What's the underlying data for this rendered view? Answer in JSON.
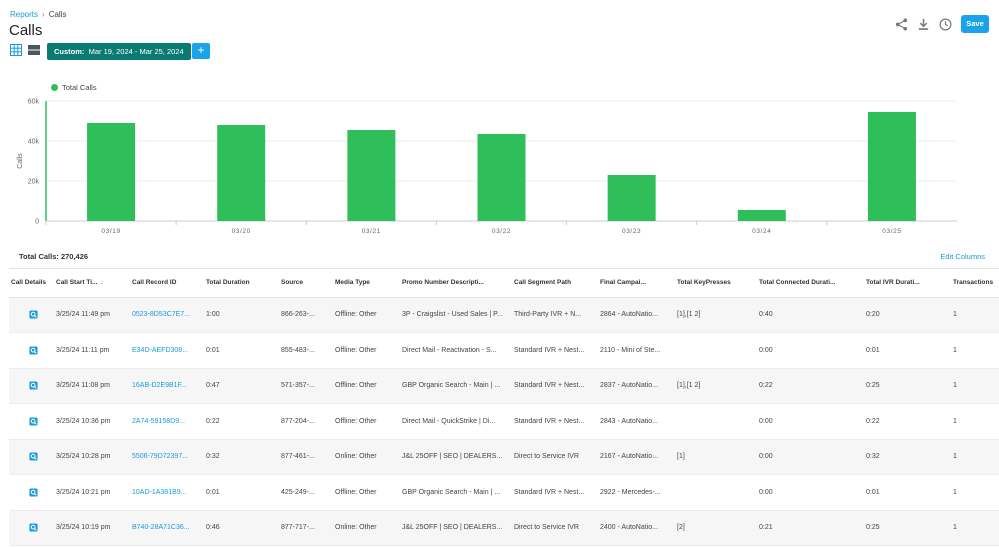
{
  "breadcrumb": {
    "parent": "Reports",
    "separator": "›",
    "current": "Calls"
  },
  "page": {
    "title": "Calls"
  },
  "toolbar": {
    "date_label": "Custom:",
    "date_range": "Mar 19, 2024 - Mar 25, 2024",
    "add_label": "+",
    "save_label": "Save",
    "icons": [
      "grid-view-icon",
      "list-view-icon",
      "share-icon",
      "download-icon",
      "clock-icon"
    ]
  },
  "colors": {
    "accent": "#1aa3e8",
    "bar": "#2fbf5a",
    "date_button": "#0b7a73",
    "link": "#1a9ad9"
  },
  "chart_data": {
    "type": "bar",
    "categories": [
      "03/19",
      "03/20",
      "03/21",
      "03/22",
      "03/23",
      "03/24",
      "03/25"
    ],
    "series": [
      {
        "name": "Total Calls",
        "values": [
          49000,
          48000,
          45500,
          43500,
          23000,
          5500,
          54500
        ]
      }
    ],
    "ylabel": "Calls",
    "ylim": [
      0,
      60000
    ],
    "yticks": [
      "0",
      "20k",
      "40k",
      "60k"
    ],
    "grid": true,
    "legend": "top-left"
  },
  "summary": {
    "total_calls": "Total Calls: 270,426",
    "edit_columns": "Edit Columns"
  },
  "table": {
    "columns": [
      "Call Details",
      "Call Start Ti...",
      "Call Record ID",
      "Total Duration",
      "Source",
      "Media Type",
      "Promo Number Descripti...",
      "Call Segment Path",
      "Final Campai...",
      "Total KeyPresses",
      "Total Connected Durati...",
      "Total IVR Durati...",
      "Transactions"
    ],
    "sort_icon": "arrow-down-icon",
    "rows": [
      [
        "",
        "3/25/24 11:49 pm",
        "0523-8D53C7E7...",
        "1:00",
        "866-263-...",
        "Offline: Other",
        "3P - Craigslist - Used Sales | P...",
        "Third-Party IVR + N...",
        "2864 - AutoNatio...",
        "[1],[1 2]",
        "0:40",
        "0:20",
        "1"
      ],
      [
        "",
        "3/25/24 11:11 pm",
        "E34D-AEFD308...",
        "0:01",
        "855-483-...",
        "Offline: Other",
        "Direct Mail - Reactivation - S...",
        "Standard IVR + Nest...",
        "2110 - Mini of Ste...",
        "",
        "0:00",
        "0:01",
        "1"
      ],
      [
        "",
        "3/25/24 11:08 pm",
        "16AB-D2E9B1F...",
        "0:47",
        "571-357-...",
        "Offline: Other",
        "GBP Organic Search - Main | ...",
        "Standard IVR + Nest...",
        "2837 - AutoNatio...",
        "[1],[1 2]",
        "0:22",
        "0:25",
        "1"
      ],
      [
        "",
        "3/25/24 10:36 pm",
        "2A74-59158D9...",
        "0:22",
        "877-204-...",
        "Offline: Other",
        "Direct Mail - QuickStrike | Di...",
        "Standard IVR + Nest...",
        "2843 - AutoNatio...",
        "",
        "0:00",
        "0:22",
        "1"
      ],
      [
        "",
        "3/25/24 10:28 pm",
        "5506-79D72397...",
        "0:32",
        "877-461-...",
        "Online: Other",
        "J&L 25OFF | SEO | DEALERS...",
        "Direct to Service IVR",
        "2167 - AutoNatio...",
        "[1]",
        "0:00",
        "0:32",
        "1"
      ],
      [
        "",
        "3/25/24 10:21 pm",
        "10AD-1A381B9...",
        "0:01",
        "425-249-...",
        "Offline: Other",
        "GBP Organic Search - Main | ...",
        "Standard IVR + Nest...",
        "2922 - Mercedes-...",
        "",
        "0:00",
        "0:01",
        "1"
      ],
      [
        "",
        "3/25/24 10:19 pm",
        "B740-28A71C36...",
        "0:46",
        "877-717-...",
        "Online: Other",
        "J&L 25OFF | SEO | DEALERS...",
        "Direct to Service IVR",
        "2400 - AutoNatio...",
        "[2]",
        "0:21",
        "0:25",
        "1"
      ]
    ]
  }
}
